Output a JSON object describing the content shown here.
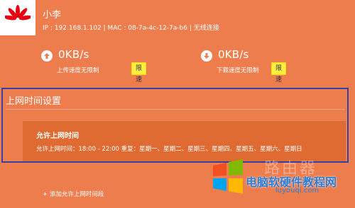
{
  "device": {
    "name": "小李",
    "info": "IP : 192.168.1.102 | MAC : 08-7a-4c-12-7a-b6 | 无线连接"
  },
  "upload": {
    "speed": "0KB/s",
    "label": "上传速度无限制",
    "button": "限速"
  },
  "download": {
    "speed": "0KB/s",
    "label": "下载速度无限制",
    "button": "限速"
  },
  "section": {
    "title": "上网时间设置"
  },
  "rule": {
    "title": "允许上网时间",
    "detail": "允许上网时间：18:00 - 22:00   重复：星期一、星期二、星期三、星期四、星期五、星期六、星期日"
  },
  "add_link": "+ 添加允许上网时间段",
  "watermark": {
    "text": "电脑软硬件教程网",
    "url": "luyouqi.com",
    "bg": "路由器"
  },
  "colors": {
    "background": "#ee7d4e",
    "panel": "#e06b32",
    "accent_button": "#ffef45",
    "highlight_border": "#3442a7"
  },
  "icons": {
    "brand": "huawei-logo",
    "upload": "upload-arrow-icon",
    "download": "download-arrow-icon",
    "flag": "windows-flag-icon"
  }
}
